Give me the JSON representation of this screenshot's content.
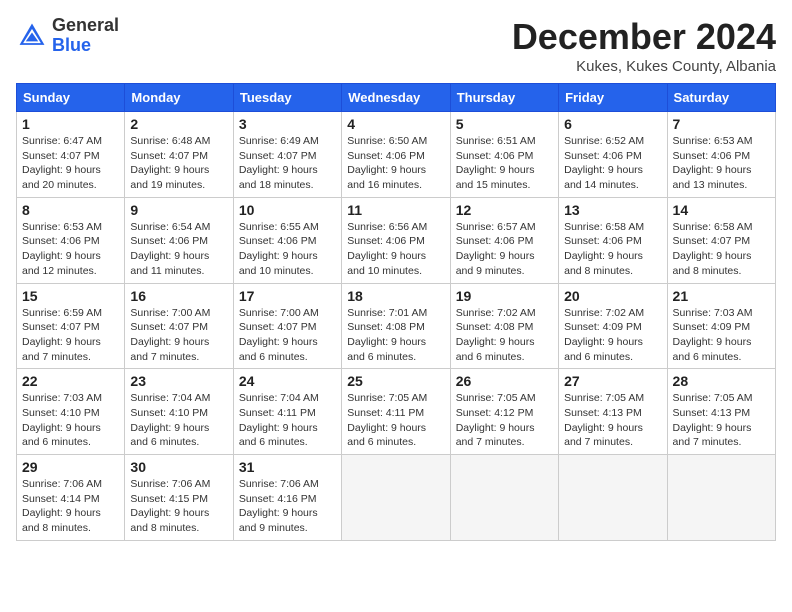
{
  "header": {
    "logo_general": "General",
    "logo_blue": "Blue",
    "month_title": "December 2024",
    "subtitle": "Kukes, Kukes County, Albania"
  },
  "weekdays": [
    "Sunday",
    "Monday",
    "Tuesday",
    "Wednesday",
    "Thursday",
    "Friday",
    "Saturday"
  ],
  "weeks": [
    [
      {
        "day": "1",
        "sunrise": "Sunrise: 6:47 AM",
        "sunset": "Sunset: 4:07 PM",
        "daylight": "Daylight: 9 hours and 20 minutes."
      },
      {
        "day": "2",
        "sunrise": "Sunrise: 6:48 AM",
        "sunset": "Sunset: 4:07 PM",
        "daylight": "Daylight: 9 hours and 19 minutes."
      },
      {
        "day": "3",
        "sunrise": "Sunrise: 6:49 AM",
        "sunset": "Sunset: 4:07 PM",
        "daylight": "Daylight: 9 hours and 18 minutes."
      },
      {
        "day": "4",
        "sunrise": "Sunrise: 6:50 AM",
        "sunset": "Sunset: 4:06 PM",
        "daylight": "Daylight: 9 hours and 16 minutes."
      },
      {
        "day": "5",
        "sunrise": "Sunrise: 6:51 AM",
        "sunset": "Sunset: 4:06 PM",
        "daylight": "Daylight: 9 hours and 15 minutes."
      },
      {
        "day": "6",
        "sunrise": "Sunrise: 6:52 AM",
        "sunset": "Sunset: 4:06 PM",
        "daylight": "Daylight: 9 hours and 14 minutes."
      },
      {
        "day": "7",
        "sunrise": "Sunrise: 6:53 AM",
        "sunset": "Sunset: 4:06 PM",
        "daylight": "Daylight: 9 hours and 13 minutes."
      }
    ],
    [
      {
        "day": "8",
        "sunrise": "Sunrise: 6:53 AM",
        "sunset": "Sunset: 4:06 PM",
        "daylight": "Daylight: 9 hours and 12 minutes."
      },
      {
        "day": "9",
        "sunrise": "Sunrise: 6:54 AM",
        "sunset": "Sunset: 4:06 PM",
        "daylight": "Daylight: 9 hours and 11 minutes."
      },
      {
        "day": "10",
        "sunrise": "Sunrise: 6:55 AM",
        "sunset": "Sunset: 4:06 PM",
        "daylight": "Daylight: 9 hours and 10 minutes."
      },
      {
        "day": "11",
        "sunrise": "Sunrise: 6:56 AM",
        "sunset": "Sunset: 4:06 PM",
        "daylight": "Daylight: 9 hours and 10 minutes."
      },
      {
        "day": "12",
        "sunrise": "Sunrise: 6:57 AM",
        "sunset": "Sunset: 4:06 PM",
        "daylight": "Daylight: 9 hours and 9 minutes."
      },
      {
        "day": "13",
        "sunrise": "Sunrise: 6:58 AM",
        "sunset": "Sunset: 4:06 PM",
        "daylight": "Daylight: 9 hours and 8 minutes."
      },
      {
        "day": "14",
        "sunrise": "Sunrise: 6:58 AM",
        "sunset": "Sunset: 4:07 PM",
        "daylight": "Daylight: 9 hours and 8 minutes."
      }
    ],
    [
      {
        "day": "15",
        "sunrise": "Sunrise: 6:59 AM",
        "sunset": "Sunset: 4:07 PM",
        "daylight": "Daylight: 9 hours and 7 minutes."
      },
      {
        "day": "16",
        "sunrise": "Sunrise: 7:00 AM",
        "sunset": "Sunset: 4:07 PM",
        "daylight": "Daylight: 9 hours and 7 minutes."
      },
      {
        "day": "17",
        "sunrise": "Sunrise: 7:00 AM",
        "sunset": "Sunset: 4:07 PM",
        "daylight": "Daylight: 9 hours and 6 minutes."
      },
      {
        "day": "18",
        "sunrise": "Sunrise: 7:01 AM",
        "sunset": "Sunset: 4:08 PM",
        "daylight": "Daylight: 9 hours and 6 minutes."
      },
      {
        "day": "19",
        "sunrise": "Sunrise: 7:02 AM",
        "sunset": "Sunset: 4:08 PM",
        "daylight": "Daylight: 9 hours and 6 minutes."
      },
      {
        "day": "20",
        "sunrise": "Sunrise: 7:02 AM",
        "sunset": "Sunset: 4:09 PM",
        "daylight": "Daylight: 9 hours and 6 minutes."
      },
      {
        "day": "21",
        "sunrise": "Sunrise: 7:03 AM",
        "sunset": "Sunset: 4:09 PM",
        "daylight": "Daylight: 9 hours and 6 minutes."
      }
    ],
    [
      {
        "day": "22",
        "sunrise": "Sunrise: 7:03 AM",
        "sunset": "Sunset: 4:10 PM",
        "daylight": "Daylight: 9 hours and 6 minutes."
      },
      {
        "day": "23",
        "sunrise": "Sunrise: 7:04 AM",
        "sunset": "Sunset: 4:10 PM",
        "daylight": "Daylight: 9 hours and 6 minutes."
      },
      {
        "day": "24",
        "sunrise": "Sunrise: 7:04 AM",
        "sunset": "Sunset: 4:11 PM",
        "daylight": "Daylight: 9 hours and 6 minutes."
      },
      {
        "day": "25",
        "sunrise": "Sunrise: 7:05 AM",
        "sunset": "Sunset: 4:11 PM",
        "daylight": "Daylight: 9 hours and 6 minutes."
      },
      {
        "day": "26",
        "sunrise": "Sunrise: 7:05 AM",
        "sunset": "Sunset: 4:12 PM",
        "daylight": "Daylight: 9 hours and 7 minutes."
      },
      {
        "day": "27",
        "sunrise": "Sunrise: 7:05 AM",
        "sunset": "Sunset: 4:13 PM",
        "daylight": "Daylight: 9 hours and 7 minutes."
      },
      {
        "day": "28",
        "sunrise": "Sunrise: 7:05 AM",
        "sunset": "Sunset: 4:13 PM",
        "daylight": "Daylight: 9 hours and 7 minutes."
      }
    ],
    [
      {
        "day": "29",
        "sunrise": "Sunrise: 7:06 AM",
        "sunset": "Sunset: 4:14 PM",
        "daylight": "Daylight: 9 hours and 8 minutes."
      },
      {
        "day": "30",
        "sunrise": "Sunrise: 7:06 AM",
        "sunset": "Sunset: 4:15 PM",
        "daylight": "Daylight: 9 hours and 8 minutes."
      },
      {
        "day": "31",
        "sunrise": "Sunrise: 7:06 AM",
        "sunset": "Sunset: 4:16 PM",
        "daylight": "Daylight: 9 hours and 9 minutes."
      },
      null,
      null,
      null,
      null
    ]
  ]
}
